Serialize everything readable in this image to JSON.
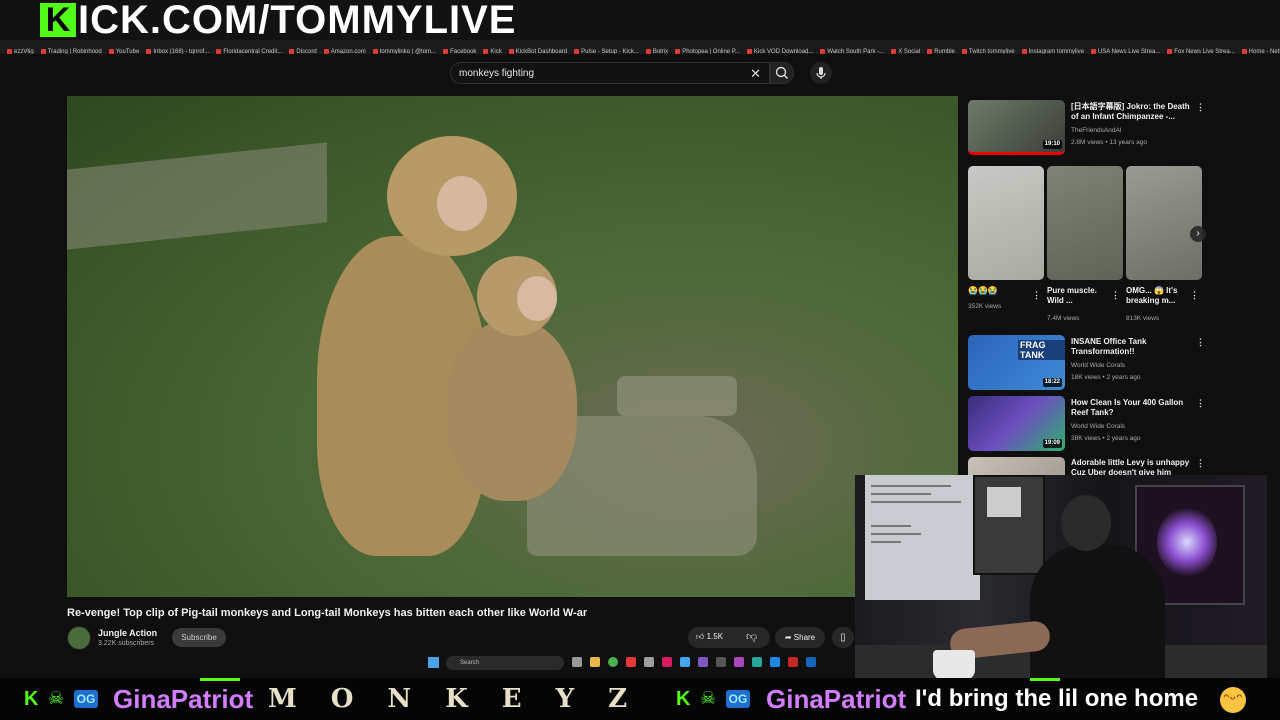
{
  "overlay": {
    "logo_letter": "K",
    "stream_url": "ICK.COM/TOMMYLIVE"
  },
  "bookmarks": [
    "ezzVtig",
    "Trading | Robinhood",
    "YouTube",
    "Inbox (168) - tqnrof...",
    "Floridacentral Credit...",
    "Discord",
    "Amazon.com",
    "tommylinko | @tom...",
    "Facebook",
    "Kick",
    "KickBot Dashboard",
    "Pulse - Setup - Kick...",
    "Botrix",
    "Photopea | Online P...",
    "Kick VOD Download...",
    "Watch South Park -...",
    "X Social",
    "Rumble",
    "Twitch tommylive",
    "Instagram tommylive",
    "USA News Live Strea...",
    "Fox News Live Strea...",
    "Home - Netflix"
  ],
  "search": {
    "query": "monkeys fighting",
    "clear_icon": "close-icon",
    "search_icon": "search-icon",
    "mic_icon": "mic-icon"
  },
  "video": {
    "title": "Re-venge! Top clip of Pig-tail monkeys and Long-tail Monkeys has bitten each other like World W-ar",
    "channel": "Jungle Action",
    "subscribers": "3.22K subscribers",
    "subscribe_label": "Subscribe",
    "likes": "1.5K",
    "share_label": "Share"
  },
  "taskbar": {
    "search_placeholder": "Search"
  },
  "sidebar": {
    "top_video": {
      "title": "[日本語字幕版] Jokro: the Death of an Infant Chimpanzee -...",
      "channel": "TheFriendsAndAI",
      "meta": "2.8M views • 13 years ago",
      "duration": "19:10"
    },
    "shorts": [
      {
        "title": "😭😭😭",
        "views": "352K views"
      },
      {
        "title": "Pure muscle. Wild ...",
        "views": "7.4M views"
      },
      {
        "title": "OMG... 😱 It's breaking m...",
        "views": "813K views"
      }
    ],
    "videos": [
      {
        "title": "INSANE Office Tank Transformation!!",
        "channel": "World Wide Corals",
        "meta": "18K views • 2 years ago",
        "duration": "18:22",
        "thumb_text": "FRAG TANK"
      },
      {
        "title": "How Clean Is Your 400 Gallon Reef Tank?",
        "channel": "World Wide Corals",
        "meta": "38K views • 2 years ago",
        "duration": "19:09"
      },
      {
        "title": "Adorable little Levy is unhappy Cuz Uber doesn't give him",
        "channel": "",
        "meta": "",
        "duration": ""
      }
    ]
  },
  "chat": {
    "username1": "GinaPatriot",
    "message1": "MONKEYZ",
    "username2": "GinaPatriot",
    "message2": "I'd bring the lil one home",
    "badge_text": "OG"
  },
  "colors": {
    "kick_green": "#53fc18",
    "username": "#d27cff",
    "background": "#0f0f0f"
  }
}
